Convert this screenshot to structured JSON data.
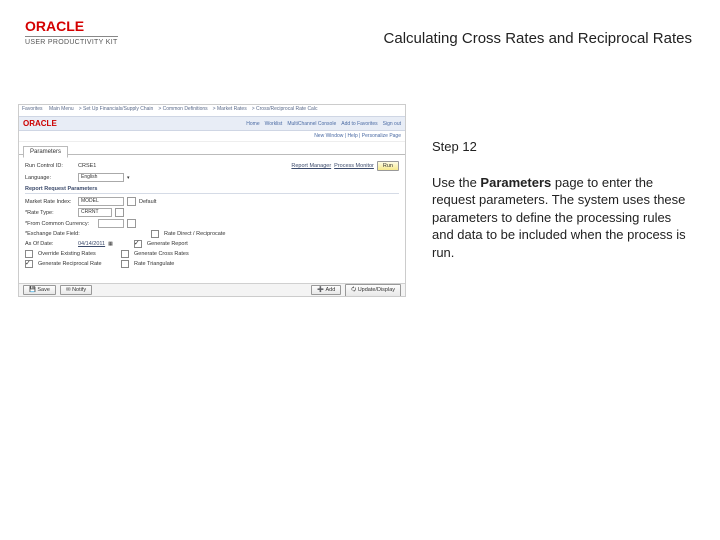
{
  "brand": {
    "name": "ORACLE",
    "sub": "USER PRODUCTIVITY KIT"
  },
  "title": "Calculating Cross Rates and Reciprocal Rates",
  "step": {
    "label": "Step 12",
    "text_before": "Use the ",
    "text_bold": "Parameters",
    "text_after": " page to enter the request parameters. The system uses these parameters to define the processing rules and data to be included when the process is run."
  },
  "shot": {
    "menubar": {
      "items": [
        "Favorites",
        "Main Menu",
        "Set Up Financials/Supply Chain",
        "Common Definitions",
        "Market Rates",
        "Cross/Reciprocal Rate Calc"
      ]
    },
    "logo": "ORACLE",
    "navlinks": [
      "Home",
      "Worklist",
      "MultiChannel Console",
      "Add to Favorites",
      "Sign out"
    ],
    "crumb": "New Window | Help | Personalize Page",
    "tab": "Parameters",
    "run_ctrl_label": "Run Control ID:",
    "run_ctrl_val": "CRSE1",
    "report_mgr": "Report Manager",
    "proc_mon": "Process Monitor",
    "run_btn": "Run",
    "language_label": "Language:",
    "language_val": "English",
    "section": "Report Request Parameters",
    "mrindex_label": "Market Rate Index:",
    "mrindex_val": "MODEL",
    "mrtype_label": "*Rate Type:",
    "mrtype_val": "CRRNT",
    "fromcur_label": "*From Common Currency:",
    "exdate_label": "*Exchange Date Field:",
    "asof_label": "As Of Date:",
    "asof_val": "04/14/2011",
    "default": "Default",
    "chk_gen_report": "Generate Report",
    "chk_recip": "Rate Direct / Reciprocate",
    "chk_override": "Override Existing Rates",
    "chk_cross": "Generate Cross Rates",
    "chk_recip_rate": "Generate Reciprocal Rate",
    "chk_triang": "Rate Triangulate",
    "footer": {
      "save": "Save",
      "notify": "Notify",
      "add": "Add",
      "update": "Update/Display"
    }
  }
}
